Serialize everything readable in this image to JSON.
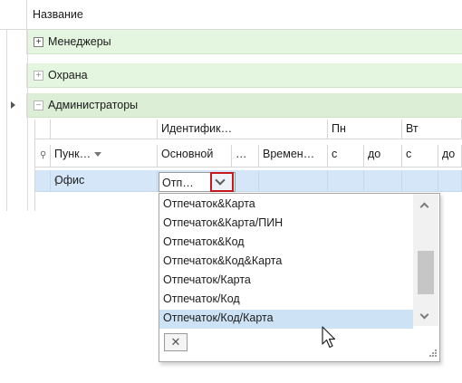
{
  "grid": {
    "header_title": "Название",
    "groups": [
      {
        "expander": "+",
        "label": "Менеджеры"
      },
      {
        "expander": "+",
        "label": "Охрана"
      },
      {
        "expander": "−",
        "label": "Администраторы"
      }
    ]
  },
  "subgrid": {
    "bands": {
      "id_band": "Идентифик…",
      "mon": "Пн",
      "tue": "Вт"
    },
    "columns": {
      "point": "Пунк…",
      "main": "Основной",
      "ellipsis": "…",
      "time": "Времен…",
      "mon_from": "с",
      "mon_to": "до",
      "tue_from": "с",
      "tue_to": "до"
    },
    "row": {
      "point": "Офис",
      "main_value": "Отп…"
    }
  },
  "dropdown": {
    "options": [
      "Отпечаток&Карта",
      "Отпечаток&Карта/ПИН",
      "Отпечаток&Код",
      "Отпечаток&Код&Карта",
      "Отпечаток/Карта",
      "Отпечаток/Код",
      "Отпечаток/Код/Карта"
    ],
    "selected_index": 6,
    "clear_label": "✕"
  },
  "colors": {
    "group_bg": "#e4f5e0",
    "data_row_bg": "#d4e6f8",
    "dropdown_highlight": "#c8161d",
    "selected_option": "#cde3f5"
  }
}
